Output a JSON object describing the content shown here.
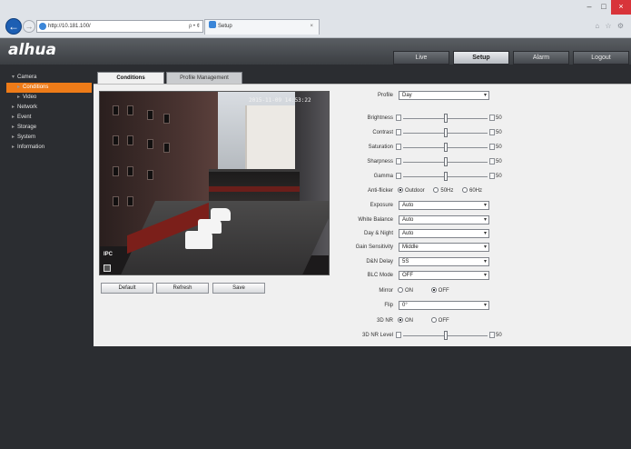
{
  "browser": {
    "address": "http://10.181.100/",
    "address_controls": "ρ • ¢",
    "tab_title": "Setup",
    "tab_close": "×",
    "window_controls": {
      "minimize": "–",
      "maximize": "□",
      "close": "×"
    },
    "toolbar_icons": "⌂ ☆ ⚙"
  },
  "header": {
    "logo": "alhua",
    "nav": [
      {
        "label": "Live",
        "active": false
      },
      {
        "label": "Setup",
        "active": true
      },
      {
        "label": "Alarm",
        "active": false
      },
      {
        "label": "Logout",
        "active": false
      }
    ]
  },
  "sidebar": {
    "items": [
      {
        "label": "Camera",
        "caret": "▾",
        "active": false
      },
      {
        "label": "Conditions",
        "caret": "▸",
        "active": true
      },
      {
        "label": "Video",
        "caret": "▸",
        "active": false
      },
      {
        "label": "Network",
        "caret": "▸",
        "active": false
      },
      {
        "label": "Event",
        "caret": "▸",
        "active": false
      },
      {
        "label": "Storage",
        "caret": "▸",
        "active": false
      },
      {
        "label": "System",
        "caret": "▸",
        "active": false
      },
      {
        "label": "Information",
        "caret": "▸",
        "active": false
      }
    ]
  },
  "subtabs": {
    "conditions": "Conditions",
    "profile": "Profile Management"
  },
  "video": {
    "osd_time": "2015-11-09 14:53:22",
    "osd_name": "IPC"
  },
  "actions": {
    "default": "Default",
    "refresh": "Refresh",
    "save": "Save"
  },
  "form": {
    "profile": {
      "label": "Profile",
      "value": "Day"
    },
    "brightness": {
      "label": "Brightness",
      "value": "50",
      "fraction": 0.5
    },
    "contrast": {
      "label": "Contrast",
      "value": "50",
      "fraction": 0.5
    },
    "saturation": {
      "label": "Saturation",
      "value": "50",
      "fraction": 0.5
    },
    "sharpness": {
      "label": "Sharpness",
      "value": "50",
      "fraction": 0.5
    },
    "gamma": {
      "label": "Gamma",
      "value": "50",
      "fraction": 0.5
    },
    "antiflicker": {
      "label": "Anti-flicker",
      "options": [
        "Outdoor",
        "50Hz",
        "60Hz"
      ],
      "selected": 0
    },
    "exposure": {
      "label": "Exposure",
      "value": "Auto"
    },
    "white_balance": {
      "label": "White Balance",
      "value": "Auto"
    },
    "day_night": {
      "label": "Day & Night",
      "value": "Auto"
    },
    "gain_sensitivity": {
      "label": "Gain Sensitivity",
      "value": "Middle"
    },
    "blc_delay": {
      "label": "D&N Delay",
      "value": "5S"
    },
    "blc_mode": {
      "label": "BLC Mode",
      "value": "OFF"
    },
    "mirror": {
      "label": "Mirror",
      "options": [
        "ON",
        "OFF"
      ],
      "selected": 1
    },
    "flip": {
      "label": "Flip",
      "value": "0°"
    },
    "dnr_3d": {
      "label": "3D NR",
      "options": [
        "ON",
        "OFF"
      ],
      "selected": 0
    },
    "dnr_level": {
      "label": "3D NR Level",
      "value": "50",
      "fraction": 0.5
    }
  },
  "colors": {
    "accent": "#ee7b18",
    "panel": "#f0f0f0",
    "body_dark": "#2b2d31"
  }
}
